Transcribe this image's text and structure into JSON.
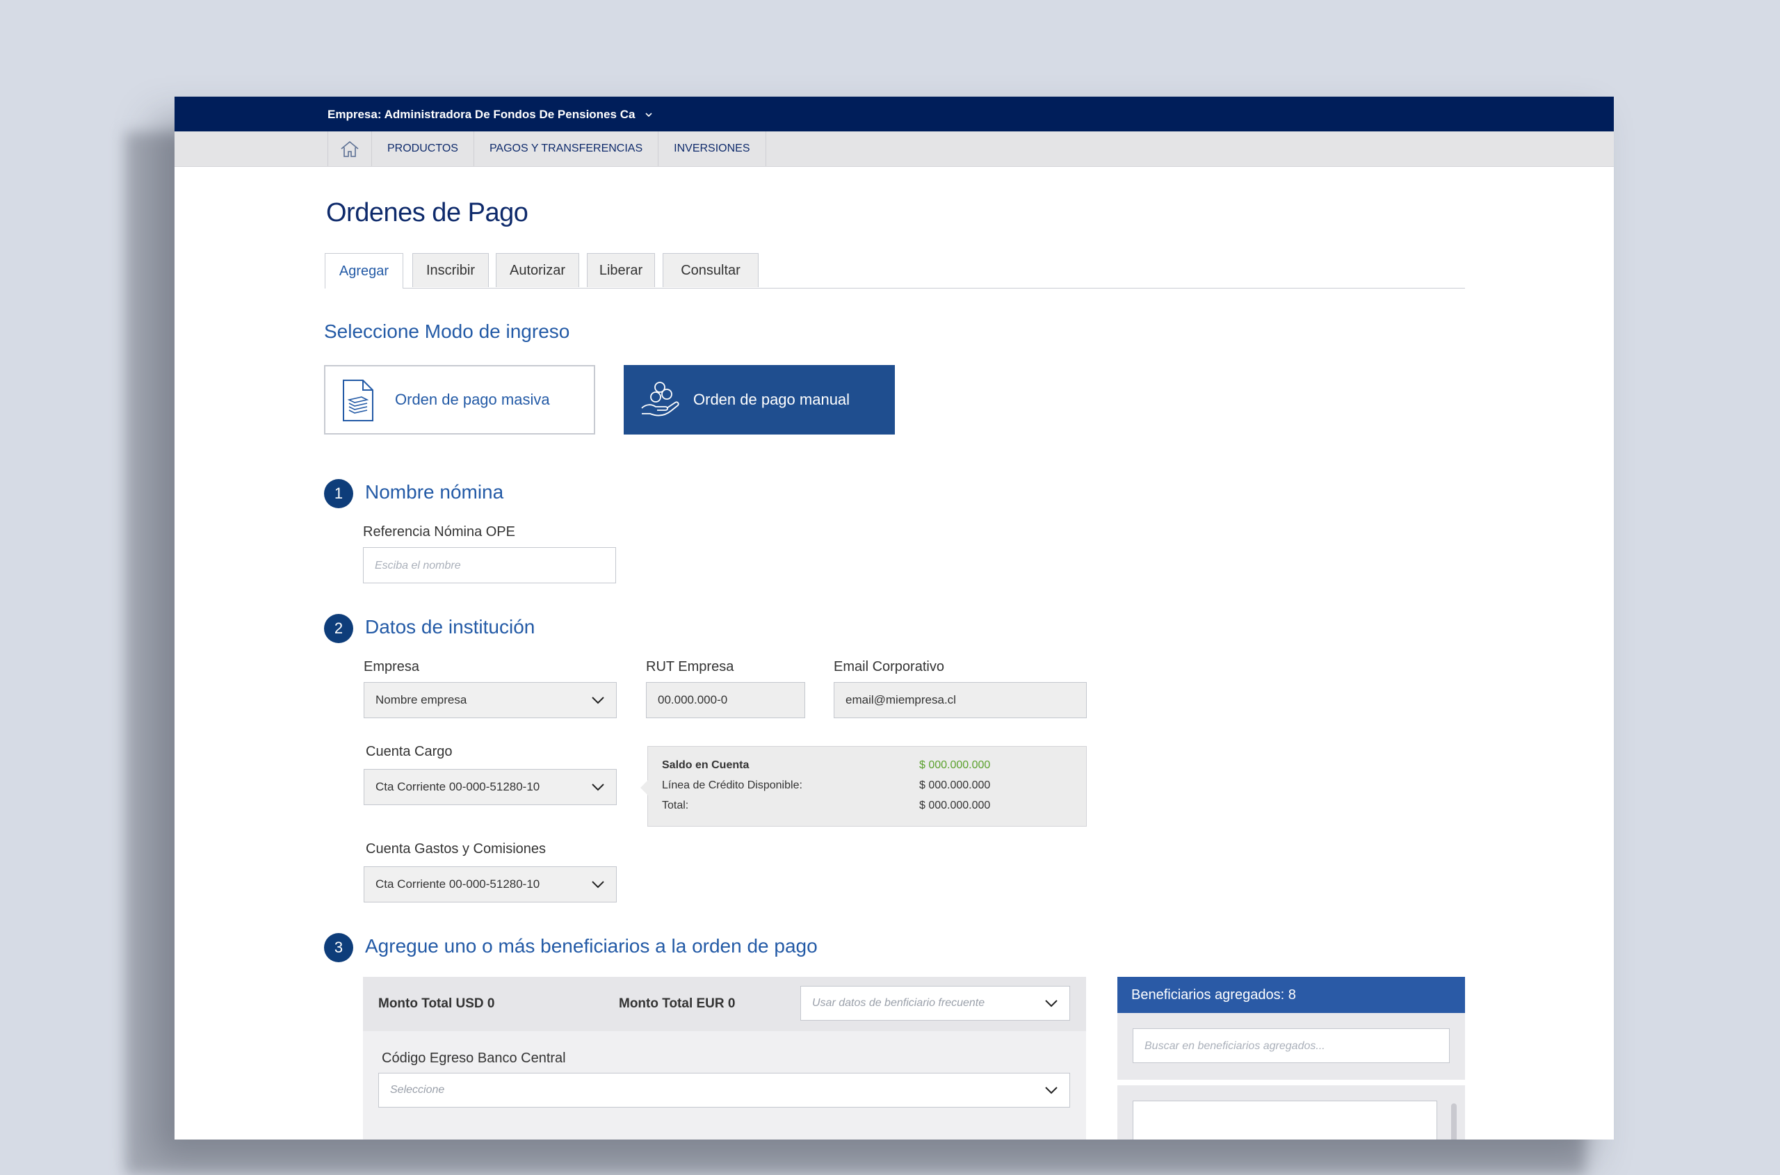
{
  "header": {
    "company_label": "Empresa: Administradora De Fondos De Pensiones Ca"
  },
  "nav": {
    "items": [
      {
        "label": "PRODUCTOS"
      },
      {
        "label": "PAGOS Y TRANSFERENCIAS"
      },
      {
        "label": "INVERSIONES"
      }
    ]
  },
  "page": {
    "title": "Ordenes de Pago"
  },
  "tabs": [
    {
      "label": "Agregar",
      "active": true
    },
    {
      "label": "Inscribir"
    },
    {
      "label": "Autorizar"
    },
    {
      "label": "Liberar"
    },
    {
      "label": "Consultar"
    }
  ],
  "mode": {
    "heading": "Seleccione Modo de ingreso",
    "masiva_label": "Orden de pago masiva",
    "manual_label": "Orden de pago manual",
    "selected": "manual"
  },
  "section1": {
    "number": "1",
    "title": "Nombre nómina",
    "field_label": "Referencia Nómina OPE",
    "placeholder": "Esciba el nombre"
  },
  "section2": {
    "number": "2",
    "title": "Datos de institución",
    "empresa_label": "Empresa",
    "empresa_value": "Nombre empresa",
    "rut_label": "RUT Empresa",
    "rut_value": "00.000.000-0",
    "email_label": "Email Corporativo",
    "email_value": "email@miempresa.cl",
    "cuenta_cargo_label": "Cuenta Cargo",
    "cuenta_cargo_value": "Cta Corriente 00-000-51280-10",
    "cuenta_gastos_label": "Cuenta Gastos y Comisiones",
    "cuenta_gastos_value": "Cta Corriente 00-000-51280-10",
    "balance": {
      "saldo_label": "Saldo en Cuenta",
      "saldo_value": "$ 000.000.000",
      "linea_label": "Línea de Crédito Disponible:",
      "linea_value": "$ 000.000.000",
      "total_label": "Total:",
      "total_value": "$ 000.000.000"
    }
  },
  "section3": {
    "number": "3",
    "title": "Agregue uno o más beneficiarios a la orden de pago",
    "monto_usd": "Monto Total USD 0",
    "monto_eur": "Monto Total EUR 0",
    "frecuente_placeholder": "Usar datos de benficiario frecuente",
    "codigo_label": "Código Egreso Banco Central",
    "codigo_placeholder": "Seleccione",
    "beneficiarios_title": "Beneficiarios agregados: 8",
    "buscar_placeholder": "Buscar en beneficiarios agregados..."
  },
  "colors": {
    "topbar": "#001e5a",
    "primary": "#235aa6",
    "button_active": "#1f4e8f",
    "positive": "#5aa02c"
  }
}
